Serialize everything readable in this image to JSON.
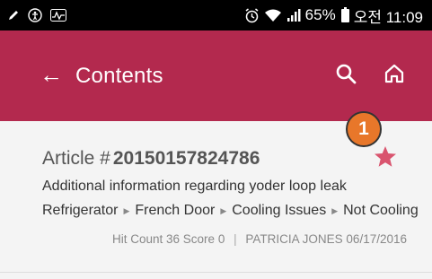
{
  "status_bar": {
    "battery": "65%",
    "time": "오전 11:09"
  },
  "app_bar": {
    "back_label": "←",
    "title": "Contents",
    "color": "#b3294e"
  },
  "article": {
    "prefix": "Article #",
    "number": "20150157824786",
    "description": "Additional information regarding yoder loop leak",
    "breadcrumbs": [
      "Refrigerator",
      "French Door",
      "Cooling Issues",
      "Not Cooling"
    ],
    "hit_count_label": "Hit Count",
    "hit_count": "36",
    "score_label": "Score",
    "score": "0",
    "author_date": "PATRICIA JONES 06/17/2016",
    "star_color": "#d9546e"
  },
  "badge": {
    "number": "1",
    "color": "#e8772a"
  }
}
